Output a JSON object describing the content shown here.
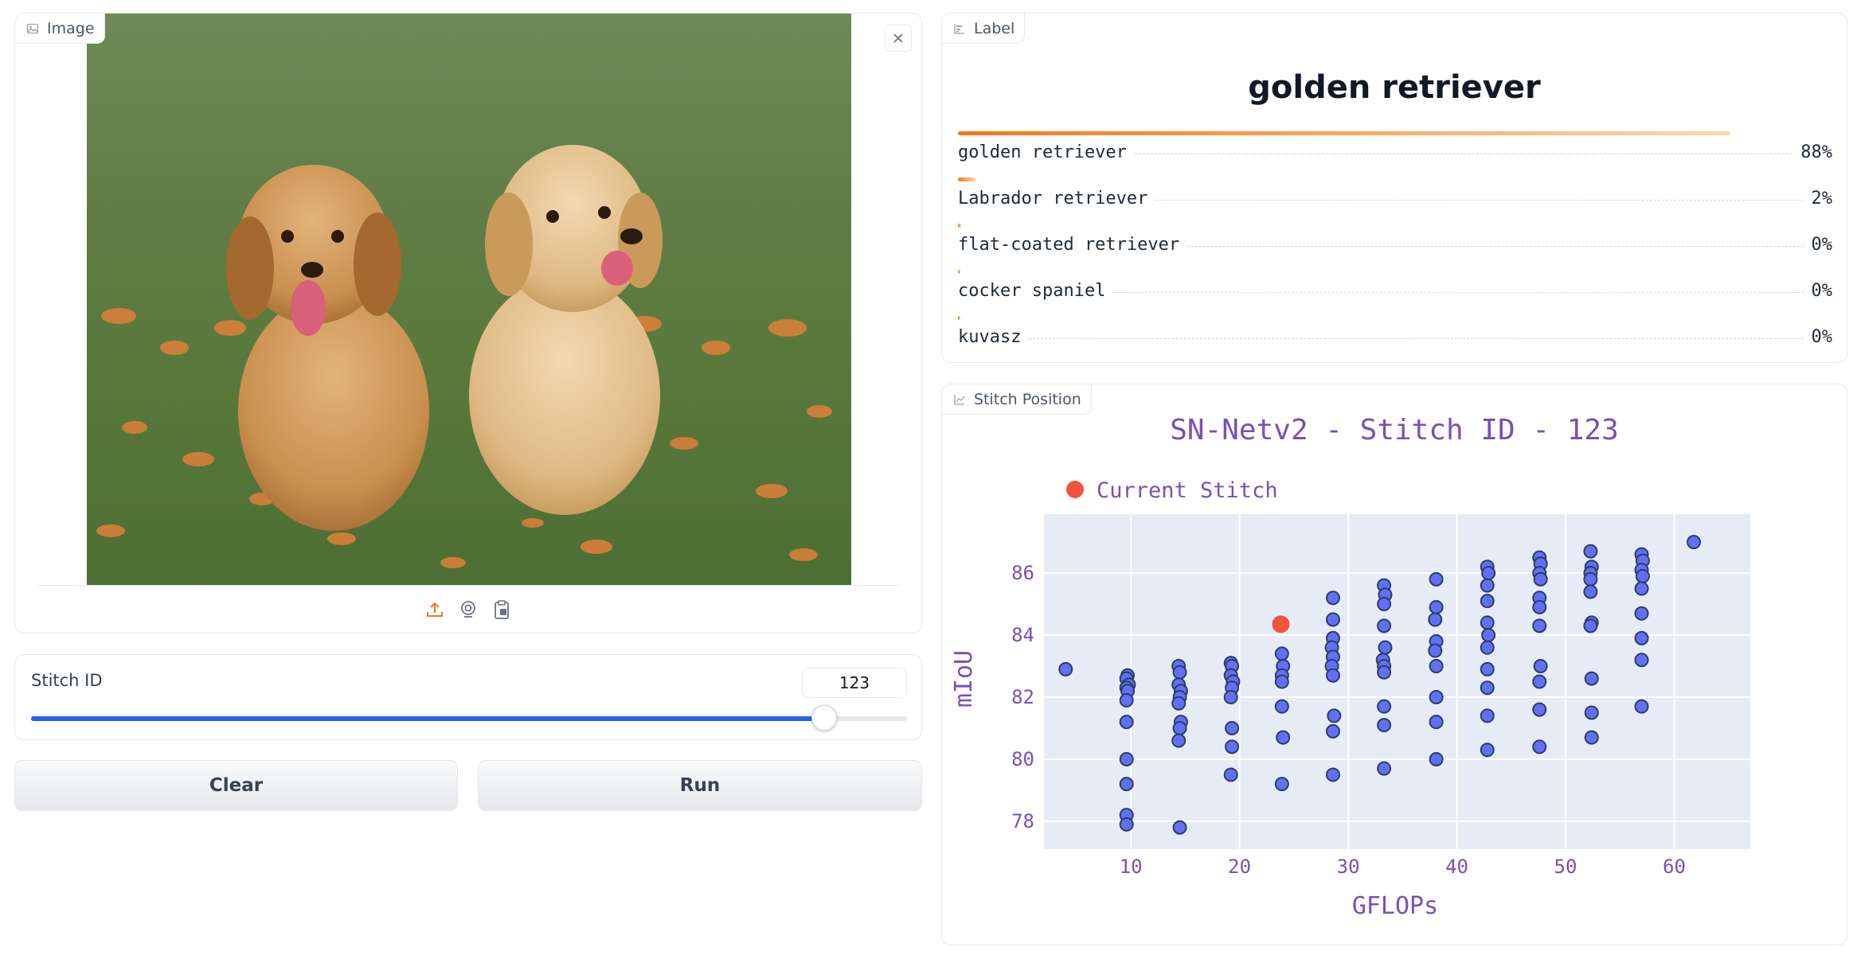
{
  "image_panel": {
    "label": "Image",
    "icon": "image-icon"
  },
  "slider": {
    "label": "Stitch ID",
    "value": "123",
    "fraction": 0.905,
    "accent": "#2563eb"
  },
  "buttons": {
    "clear": "Clear",
    "run": "Run"
  },
  "label_panel": {
    "label": "Label",
    "top_label": "golden retriever",
    "confidences": [
      {
        "name": "golden retriever",
        "pct": "88%",
        "fraction": 0.88
      },
      {
        "name": "Labrador retriever",
        "pct": "2%",
        "fraction": 0.02
      },
      {
        "name": "flat-coated retriever",
        "pct": "0%",
        "fraction": 0.004
      },
      {
        "name": "cocker spaniel",
        "pct": "0%",
        "fraction": 0.003
      },
      {
        "name": "kuvasz",
        "pct": "0%",
        "fraction": 0.002
      }
    ]
  },
  "plot_panel": {
    "label": "Stitch Position"
  },
  "chart_data": {
    "type": "scatter",
    "title": "SN-Netv2 - Stitch ID - 123",
    "xlabel": "GFLOPs",
    "ylabel": "mIoU",
    "xlim": [
      2,
      67
    ],
    "ylim": [
      77.1,
      87.9
    ],
    "xticks": [
      10,
      20,
      30,
      40,
      50,
      60
    ],
    "yticks": [
      78,
      80,
      82,
      84,
      86
    ],
    "legend": {
      "label": "Current Stitch",
      "placement": "top-left"
    },
    "grid": true,
    "colors": {
      "points": "#636efa",
      "current": "#ef553b",
      "plot_bg": "#e5ecf6",
      "text": "#7b4fb5"
    },
    "current_stitch": {
      "x": 23.8,
      "y": 84.35
    },
    "series": [
      {
        "points": [
          [
            4.0,
            82.9
          ],
          [
            9.7,
            82.7
          ],
          [
            9.6,
            82.6
          ],
          [
            9.8,
            82.4
          ],
          [
            9.6,
            82.3
          ],
          [
            9.7,
            82.2
          ],
          [
            9.6,
            81.9
          ],
          [
            9.6,
            81.2
          ],
          [
            9.6,
            80.0
          ],
          [
            9.6,
            79.2
          ],
          [
            9.6,
            78.2
          ],
          [
            9.6,
            77.9
          ],
          [
            14.4,
            83.0
          ],
          [
            14.5,
            82.8
          ],
          [
            14.4,
            82.4
          ],
          [
            14.6,
            82.2
          ],
          [
            14.5,
            82.0
          ],
          [
            14.4,
            81.8
          ],
          [
            14.6,
            81.2
          ],
          [
            14.5,
            81.0
          ],
          [
            14.4,
            80.6
          ],
          [
            14.5,
            77.8
          ],
          [
            19.2,
            83.1
          ],
          [
            19.3,
            83.0
          ],
          [
            19.2,
            82.7
          ],
          [
            19.4,
            82.5
          ],
          [
            19.3,
            82.3
          ],
          [
            19.2,
            82.0
          ],
          [
            19.3,
            81.0
          ],
          [
            19.3,
            80.4
          ],
          [
            19.2,
            79.5
          ],
          [
            23.9,
            83.4
          ],
          [
            24.0,
            83.0
          ],
          [
            23.9,
            82.7
          ],
          [
            23.9,
            82.5
          ],
          [
            23.9,
            81.7
          ],
          [
            24.0,
            80.7
          ],
          [
            23.9,
            79.2
          ],
          [
            28.6,
            85.2
          ],
          [
            28.6,
            84.5
          ],
          [
            28.6,
            83.9
          ],
          [
            28.5,
            83.6
          ],
          [
            28.6,
            83.3
          ],
          [
            28.5,
            83.0
          ],
          [
            28.6,
            82.7
          ],
          [
            28.7,
            81.4
          ],
          [
            28.6,
            80.9
          ],
          [
            28.6,
            79.5
          ],
          [
            33.3,
            85.6
          ],
          [
            33.4,
            85.3
          ],
          [
            33.3,
            85.0
          ],
          [
            33.3,
            84.3
          ],
          [
            33.4,
            83.6
          ],
          [
            33.2,
            83.2
          ],
          [
            33.3,
            83.0
          ],
          [
            33.3,
            82.8
          ],
          [
            33.3,
            81.7
          ],
          [
            33.3,
            81.1
          ],
          [
            33.3,
            79.7
          ],
          [
            38.1,
            85.8
          ],
          [
            38.1,
            84.9
          ],
          [
            38.0,
            84.5
          ],
          [
            38.1,
            83.8
          ],
          [
            38.0,
            83.5
          ],
          [
            38.1,
            83.0
          ],
          [
            38.1,
            82.0
          ],
          [
            38.1,
            81.2
          ],
          [
            38.1,
            80.0
          ],
          [
            42.8,
            86.2
          ],
          [
            42.9,
            86.0
          ],
          [
            42.8,
            85.6
          ],
          [
            42.8,
            85.1
          ],
          [
            42.8,
            84.4
          ],
          [
            42.9,
            84.0
          ],
          [
            42.8,
            83.6
          ],
          [
            42.8,
            82.9
          ],
          [
            42.8,
            82.3
          ],
          [
            42.8,
            81.4
          ],
          [
            42.8,
            80.3
          ],
          [
            47.6,
            86.5
          ],
          [
            47.7,
            86.3
          ],
          [
            47.6,
            86.0
          ],
          [
            47.7,
            85.8
          ],
          [
            47.6,
            85.2
          ],
          [
            47.6,
            84.9
          ],
          [
            47.6,
            84.3
          ],
          [
            47.7,
            83.0
          ],
          [
            47.6,
            82.5
          ],
          [
            47.6,
            81.6
          ],
          [
            47.6,
            80.4
          ],
          [
            52.3,
            86.7
          ],
          [
            52.4,
            86.2
          ],
          [
            52.3,
            86.0
          ],
          [
            52.3,
            85.8
          ],
          [
            52.3,
            85.4
          ],
          [
            52.4,
            84.4
          ],
          [
            52.3,
            84.3
          ],
          [
            52.4,
            82.6
          ],
          [
            52.4,
            81.5
          ],
          [
            52.4,
            80.7
          ],
          [
            57.0,
            86.6
          ],
          [
            57.1,
            86.4
          ],
          [
            57.0,
            86.1
          ],
          [
            57.1,
            85.9
          ],
          [
            57.0,
            85.5
          ],
          [
            57.0,
            84.7
          ],
          [
            57.0,
            83.9
          ],
          [
            57.0,
            83.2
          ],
          [
            57.0,
            81.7
          ],
          [
            61.8,
            87.0
          ]
        ]
      }
    ]
  }
}
